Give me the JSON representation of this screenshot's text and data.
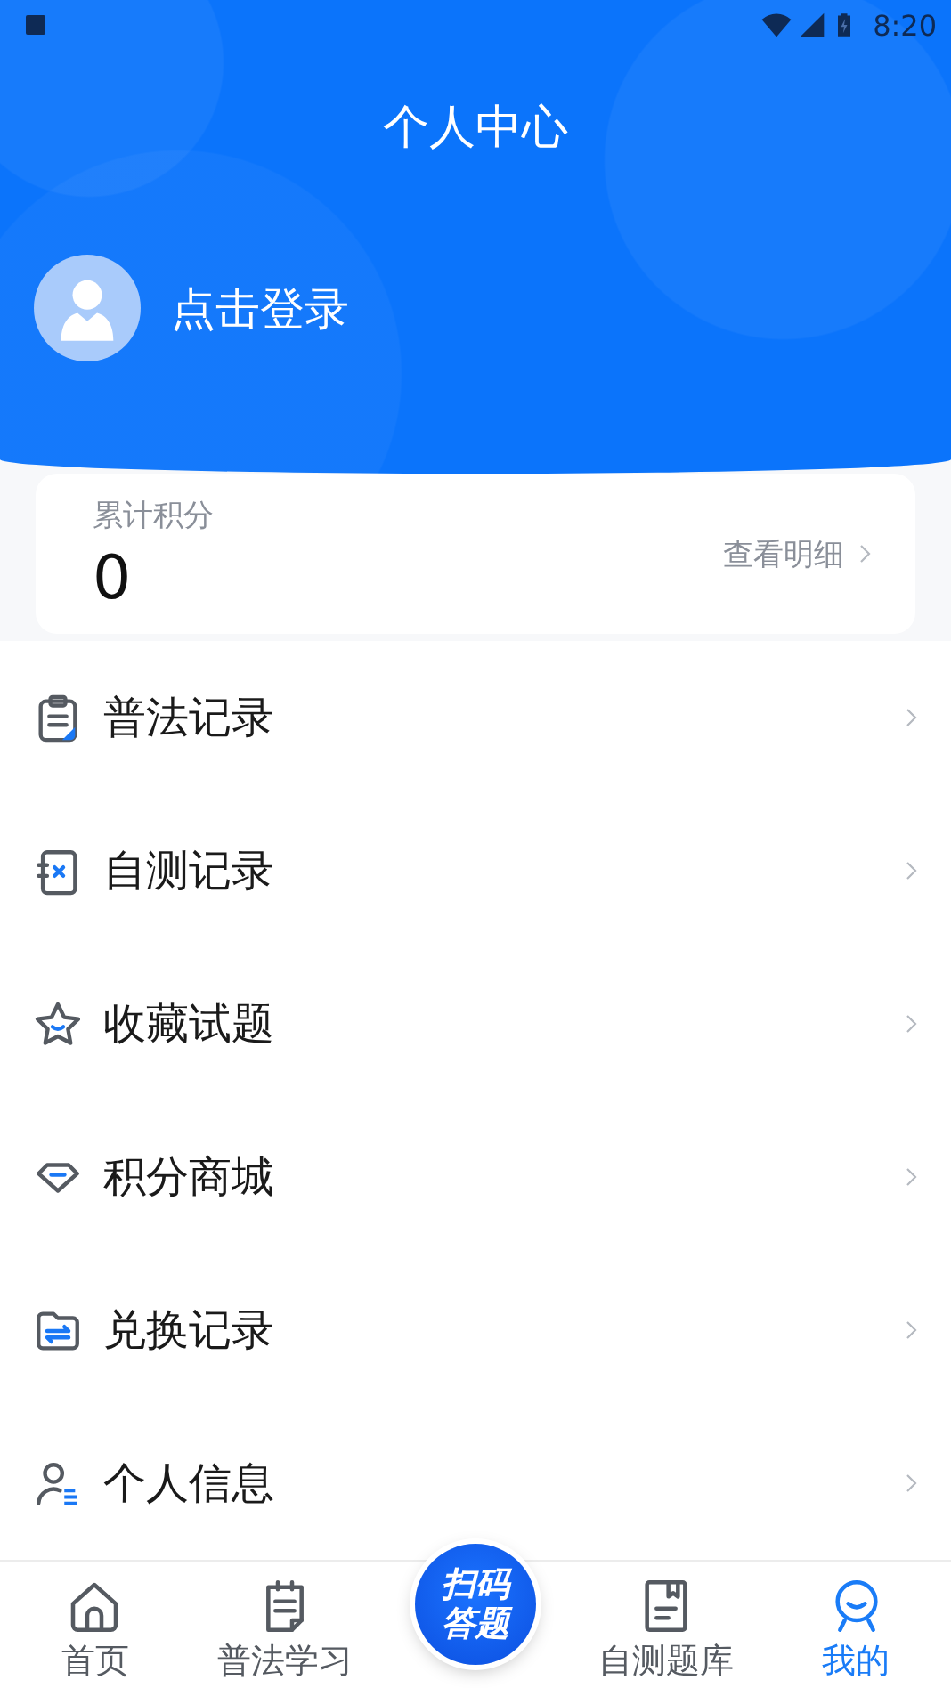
{
  "status_bar": {
    "time": "8:20"
  },
  "header": {
    "title": "个人中心",
    "login": "点击登录"
  },
  "points": {
    "label": "累计积分",
    "value": "0",
    "link": "查看明细"
  },
  "menu": [
    {
      "label": "普法记录",
      "kind": "clipboard"
    },
    {
      "label": "自测记录",
      "kind": "test"
    },
    {
      "label": "收藏试题",
      "kind": "star"
    },
    {
      "label": "积分商城",
      "kind": "gem"
    },
    {
      "label": "兑换记录",
      "kind": "folder"
    },
    {
      "label": "个人信息",
      "kind": "person"
    }
  ],
  "tabs": [
    {
      "label": "首页",
      "kind": "home",
      "selected": false
    },
    {
      "label": "普法学习",
      "kind": "notepad",
      "selected": false
    },
    {
      "label": "扫码答题",
      "kind": "scan",
      "selected": false
    },
    {
      "label": "自测题库",
      "kind": "book",
      "selected": false
    },
    {
      "label": "我的",
      "kind": "smile",
      "selected": true
    }
  ]
}
